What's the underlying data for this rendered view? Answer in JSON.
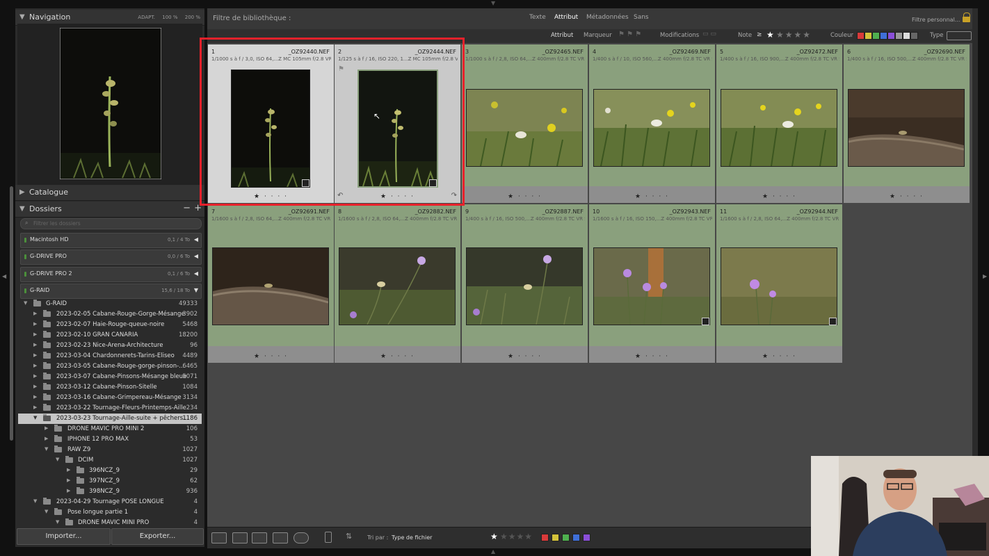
{
  "navigator": {
    "title": "Navigation",
    "zoom_options": [
      "ADAPT.",
      "100 %",
      "200 %"
    ]
  },
  "catalogue": {
    "title": "Catalogue"
  },
  "folders": {
    "title": "Dossiers",
    "search_placeholder": "Filtrer les dossiers",
    "volumes": [
      {
        "name": "Macintosh HD",
        "capacity": "0,1 / 4 To"
      },
      {
        "name": "G-DRIVE PRO",
        "capacity": "0,0 / 6 To"
      },
      {
        "name": "G-DRIVE PRO 2",
        "capacity": "0,1 / 6 To"
      },
      {
        "name": "G-RAID",
        "capacity": "15,6 / 18 To"
      }
    ],
    "tree": [
      {
        "label": "G-RAID",
        "count": "49333"
      },
      {
        "label": "2023-02-05 Cabane-Rouge-Gorge-Mésange",
        "count": "3902"
      },
      {
        "label": "2023-02-07 Haie-Rouge-queue-noire",
        "count": "5468"
      },
      {
        "label": "2023-02-10 GRAN CANARIA",
        "count": "18200"
      },
      {
        "label": "2023-02-23 Nice-Arena-Architecture",
        "count": "96"
      },
      {
        "label": "2023-03-04 Chardonnerets-Tarins-Eliseo",
        "count": "4489"
      },
      {
        "label": "2023-03-05 Cabane-Rouge-gorge-pinson-...",
        "count": "6465"
      },
      {
        "label": "2023-03-07 Cabane-Pinsons-Mésange bleue",
        "count": "5071"
      },
      {
        "label": "2023-03-12 Cabane-Pinson-Sitelle",
        "count": "1084"
      },
      {
        "label": "2023-03-16 Cabane-Grimpereau-Mésange",
        "count": "3134"
      },
      {
        "label": "2023-03-22 Tournage-Fleurs-Printemps-Aille",
        "count": "234"
      },
      {
        "label": "2023-03-23 Tournage-Aille-suite + pêchers...",
        "count": "1186"
      },
      {
        "label": "DRONE MAVIC PRO MINI 2",
        "count": "106"
      },
      {
        "label": "IPHONE 12 PRO MAX",
        "count": "53"
      },
      {
        "label": "RAW Z9",
        "count": "1027"
      },
      {
        "label": "DCIM",
        "count": "1027"
      },
      {
        "label": "396NCZ_9",
        "count": "29"
      },
      {
        "label": "397NCZ_9",
        "count": "62"
      },
      {
        "label": "398NCZ_9",
        "count": "936"
      },
      {
        "label": "2023-04-29 Tournage POSE LONGUE",
        "count": "4"
      },
      {
        "label": "Pose longue partie 1",
        "count": "4"
      },
      {
        "label": "DRONE MAVIC MINI PRO",
        "count": "4"
      }
    ]
  },
  "bottom_buttons": {
    "import": "Importer...",
    "export": "Exporter..."
  },
  "filter_bar": {
    "title": "Filtre de bibliothèque :",
    "tabs": [
      "Texte",
      "Attribut",
      "Métadonnées",
      "Sans"
    ],
    "preset": "Filtre personnal..."
  },
  "attribute_bar": {
    "attribut": "Attribut",
    "marqueur": "Marqueur",
    "modifications": "Modifications",
    "note": "Note",
    "note_op": "≥",
    "couleur": "Couleur",
    "type": "Type",
    "color_labels": [
      "#d83a3a",
      "#d4c23a",
      "#4fb04f",
      "#3f6fd8",
      "#8a4fd8",
      "#9a9a9a",
      "#dddddd",
      "#666666"
    ]
  },
  "photos": [
    {
      "num": "1",
      "file": "_OZ92440.NEF",
      "meta": "1/1000 s à f / 3,0, ISO 64,...Z MC 105mm f/2.8 VR S)",
      "stars": "★ · · · ·"
    },
    {
      "num": "2",
      "file": "_OZ92444.NEF",
      "meta": "1/125 s à f / 16, ISO 220, 1...Z MC 105mm f/2.8 VR S)",
      "stars": "★ · · · ·"
    },
    {
      "num": "3",
      "file": "_OZ92465.NEF",
      "meta": "1/1000 s à f / 2,8, ISO 64,...Z 400mm f/2.8 TC VR S)",
      "stars": "★ · · · ·"
    },
    {
      "num": "4",
      "file": "_OZ92469.NEF",
      "meta": "1/400 s à f / 10, ISO 560,...Z 400mm f/2.8 TC VR S)",
      "stars": "★ · · · ·"
    },
    {
      "num": "5",
      "file": "_OZ92472.NEF",
      "meta": "1/400 s à f / 16, ISO 900,...Z 400mm f/2.8 TC VR S)",
      "stars": "★ · · · ·"
    },
    {
      "num": "6",
      "file": "_OZ92690.NEF",
      "meta": "1/400 s à f / 16, ISO 500,...Z 400mm f/2.8 TC VR S)",
      "stars": "★ · · · ·"
    },
    {
      "num": "7",
      "file": "_OZ92691.NEF",
      "meta": "1/1600 s à f / 2,8, ISO 64,...Z 400mm f/2.8 TC VR S)",
      "stars": "★ · · · ·"
    },
    {
      "num": "8",
      "file": "_OZ92882.NEF",
      "meta": "1/1600 s à f / 2,8, ISO 64,...Z 400mm f/2.8 TC VR S)",
      "stars": "★ · · · ·"
    },
    {
      "num": "9",
      "file": "_OZ92887.NEF",
      "meta": "1/400 s à f / 16, ISO 500,...Z 400mm f/2.8 TC VR S)",
      "stars": "★ · · · ·"
    },
    {
      "num": "10",
      "file": "_OZ92943.NEF",
      "meta": "1/1600 s à f / 16, ISO 150,...Z 400mm f/2.8 TC VR S)",
      "stars": "★ · · · ·"
    },
    {
      "num": "11",
      "file": "_OZ92944.NEF",
      "meta": "1/1600 s à f / 2,8, ISO 64,...Z 400mm f/2.8 TC VR S)",
      "stars": "★ · · · ·"
    }
  ],
  "toolbar": {
    "sort_label": "Tri par :",
    "sort_value": "Type de fichier",
    "rating_filter": "★ ★ ★ ★ ★"
  }
}
